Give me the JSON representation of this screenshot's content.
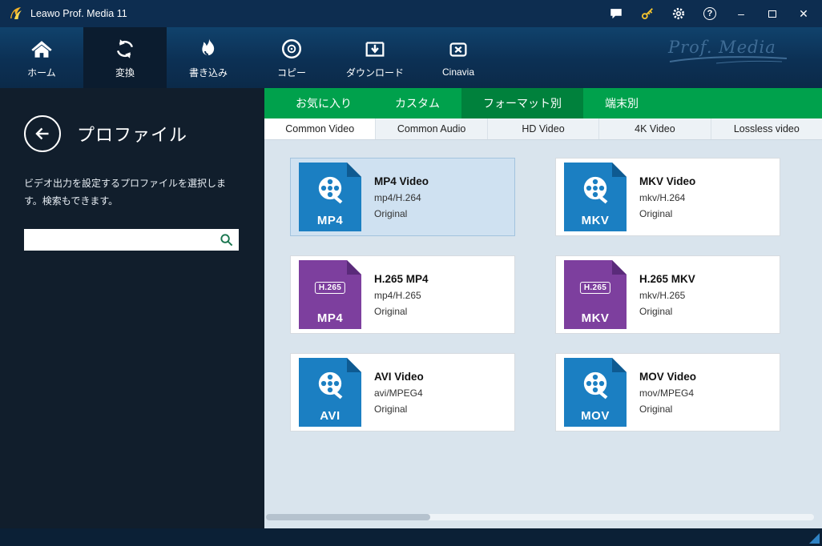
{
  "titlebar": {
    "title": "Leawo Prof. Media 11",
    "minimize": "–",
    "close": "✕",
    "help": "?"
  },
  "nav": {
    "brand": "Prof. Media",
    "items": [
      {
        "label": "ホーム"
      },
      {
        "label": "変換"
      },
      {
        "label": "書き込み"
      },
      {
        "label": "コピー"
      },
      {
        "label": "ダウンロード"
      },
      {
        "label": "Cinavia"
      }
    ]
  },
  "sidebar": {
    "title": "プロファイル",
    "description": "ビデオ出力を設定するプロファイルを選択します。検索もできます。",
    "search_value": ""
  },
  "format_tabs": [
    {
      "label": "お気に入り"
    },
    {
      "label": "カスタム"
    },
    {
      "label": "フォーマット別"
    },
    {
      "label": "端末別"
    }
  ],
  "sub_tabs": [
    {
      "label": "Common Video"
    },
    {
      "label": "Common Audio"
    },
    {
      "label": "HD Video"
    },
    {
      "label": "4K Video"
    },
    {
      "label": "Lossless video"
    }
  ],
  "cards": [
    {
      "title": "MP4 Video",
      "codec": "mp4/H.264",
      "quality": "Original",
      "badge": "MP4"
    },
    {
      "title": "MKV Video",
      "codec": "mkv/H.264",
      "quality": "Original",
      "badge": "MKV"
    },
    {
      "title": "H.265 MP4",
      "codec": "mp4/H.265",
      "quality": "Original",
      "badge": "MP4",
      "top_badge": "H.265"
    },
    {
      "title": "H.265 MKV",
      "codec": "mkv/H.265",
      "quality": "Original",
      "badge": "MKV",
      "top_badge": "H.265"
    },
    {
      "title": "AVI Video",
      "codec": "avi/MPEG4",
      "quality": "Original",
      "badge": "AVI"
    },
    {
      "title": "MOV Video",
      "codec": "mov/MPEG4",
      "quality": "Original",
      "badge": "MOV"
    }
  ],
  "colors": {
    "accent_green": "#00a14c",
    "active_green": "#00813c",
    "icon_blue": "#1b7fc2",
    "icon_purple": "#7d3f9e",
    "selected_card_bg": "#cfe1f1",
    "titlebar_bg": "#0d2d50",
    "sidebar_bg": "#111e2c",
    "content_bg": "#d9e4ed"
  },
  "icons": {
    "logo": "leawo-flame",
    "chat": "speech-bubble",
    "key": "gold-key",
    "gear": "settings-gear",
    "help": "question-circle",
    "home": "house",
    "convert": "circular-arrows",
    "burn": "flame",
    "copy": "disc",
    "download": "arrow-into-box",
    "cinavia": "crossed-box",
    "back": "left-arrow-circle",
    "search": "magnifier",
    "film": "film-reel"
  }
}
